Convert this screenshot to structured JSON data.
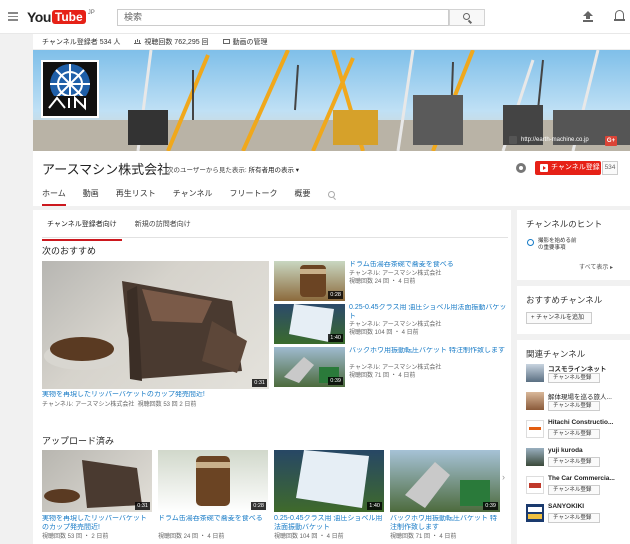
{
  "header": {
    "logo_you": "You",
    "logo_tube": "Tube",
    "logo_region": "JP",
    "search_placeholder": "検索"
  },
  "channel": {
    "stats": {
      "subscribers": "チャンネル登録者 534 人",
      "views": "視聴回数 762,295 回",
      "manage": "動画の管理"
    },
    "banner_link": "http://earth-machine.co.jp",
    "gplus": "G+",
    "title": "アースマシン株式会社",
    "view_as_label": "次のユーザーから見た表示:",
    "view_as_value": "所有者用の表示 ▾",
    "subscribe_label": "チャンネル登録",
    "subscribe_count": "534",
    "tabs": [
      "ホーム",
      "動画",
      "再生リスト",
      "チャンネル",
      "フリートーク",
      "概要"
    ]
  },
  "main": {
    "subtabs": [
      "チャンネル登録者向け",
      "新規の訪問者向け"
    ],
    "featured_title": "次のおすすめ",
    "featured": {
      "duration": "0:31",
      "title": "実物を再現したリッパーバケットのカップ発売間近!",
      "channel": "チャンネル: アースマシン株式会社",
      "meta": "視聴回数 53 回 2 日前"
    },
    "side_videos": [
      {
        "duration": "0:28",
        "title": "ドラム缶湯呑茶碗で蕎麦を食べる",
        "channel": "チャンネル: アースマシン株式会社",
        "meta": "視聴回数 24 回 ・ 4 日前"
      },
      {
        "duration": "1:40",
        "title": "0.25-0.45クラス用 油圧ショベル用法面振動バケット",
        "channel": "チャンネル: アースマシン株式会社",
        "meta": "視聴回数 104 回 ・ 4 日前"
      },
      {
        "duration": "0:39",
        "title": "バックホウ用振動転圧バケット 特注制作致します",
        "channel": "チャンネル: アースマシン株式会社",
        "meta": "視聴回数 71 回 ・ 4 日前"
      }
    ],
    "uploads_title": "アップロード済み",
    "uploads": [
      {
        "duration": "0:31",
        "title": "実物を再現したリッパーバケットのカップ発売間近!",
        "meta": "視聴回数 53 回 ・ 2 日前"
      },
      {
        "duration": "0:28",
        "title": "ドラム缶湯呑茶碗で蕎麦を食べる",
        "meta": "視聴回数 24 回 ・ 4 日前"
      },
      {
        "duration": "1:40",
        "title": "0.25-0.45クラス用 油圧ショベル用法面振動バケット",
        "meta": "視聴回数 104 回 ・ 4 日前"
      },
      {
        "duration": "0:39",
        "title": "バックホウ用振動転圧バケット 特注制作致します",
        "meta": "視聴回数 71 回 ・ 4 日前"
      }
    ]
  },
  "sidebar": {
    "hints_title": "チャンネルのヒント",
    "hint_text_1": "撮影を始める前",
    "hint_text_2": "の重要事項",
    "hints_more": "すべて表示 ▸",
    "recommended_title": "おすすめチャンネル",
    "recommended_btn": "+ チャンネルを追加",
    "related_title": "関連チャンネル",
    "related": [
      {
        "name": "コスモラインネット",
        "btn": "チャンネル登録"
      },
      {
        "name": "解体現場を巡る旅人...",
        "btn": "チャンネル登録"
      },
      {
        "name": "Hitachi Constructio...",
        "btn": "チャンネル登録"
      },
      {
        "name": "yuji kuroda",
        "btn": "チャンネル登録"
      },
      {
        "name": "The Car Commercia...",
        "btn": "チャンネル登録"
      },
      {
        "name": "SANYOKIKI",
        "btn": "チャンネル登録"
      }
    ]
  },
  "colors": {
    "brand_red": "#e62117",
    "link_blue": "#167ac6"
  }
}
